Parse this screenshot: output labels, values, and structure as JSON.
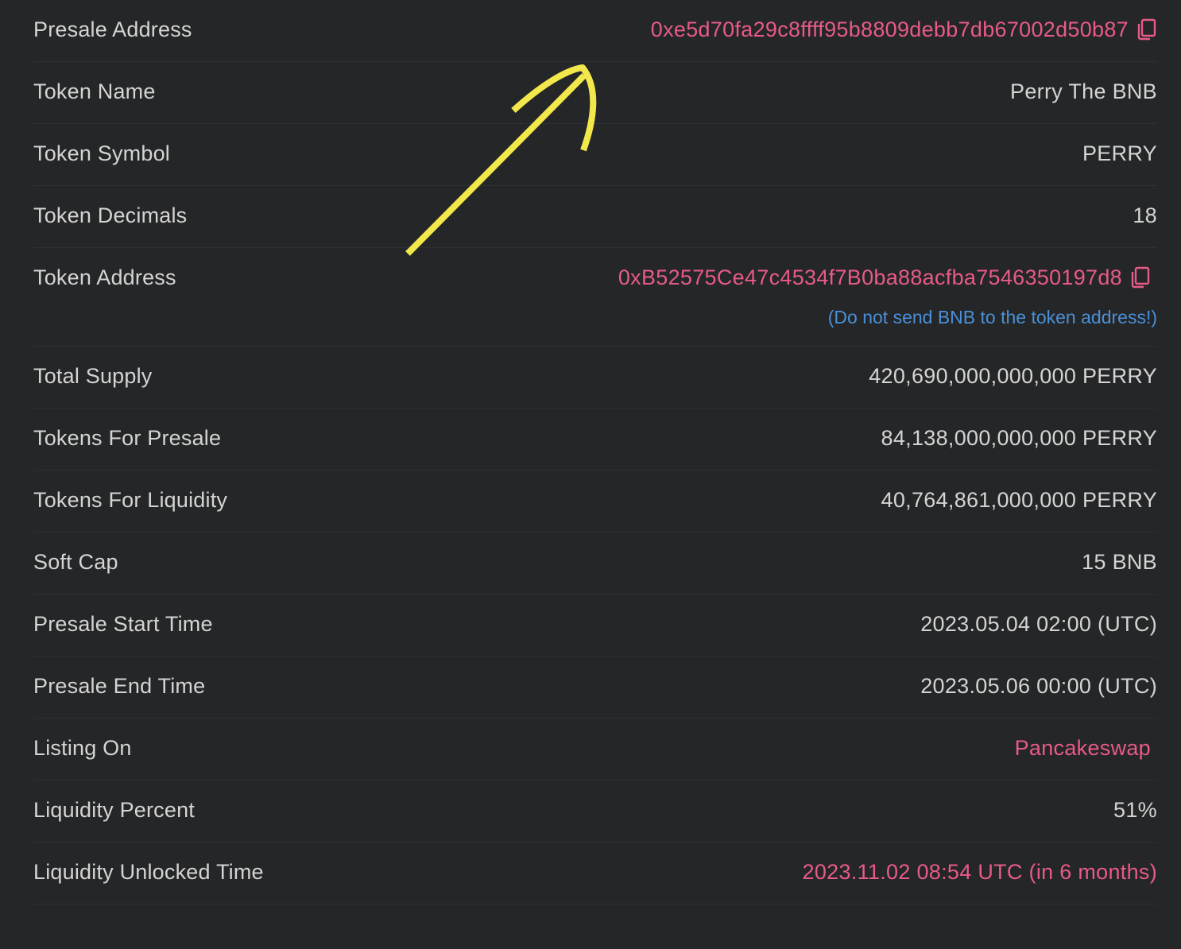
{
  "rows": [
    {
      "label": "Presale Address",
      "value": "0xe5d70fa29c8ffff95b8809debb7db67002d50b87"
    },
    {
      "label": "Token Name",
      "value": "Perry The BNB"
    },
    {
      "label": "Token Symbol",
      "value": "PERRY"
    },
    {
      "label": "Token Decimals",
      "value": "18"
    },
    {
      "label": "Token Address",
      "value": "0xB52575Ce47c4534f7B0ba88acfba7546350197d8",
      "note": "(Do not send BNB to the token address!)"
    },
    {
      "label": "Total Supply",
      "value": "420,690,000,000,000 PERRY"
    },
    {
      "label": "Tokens For Presale",
      "value": "84,138,000,000,000 PERRY"
    },
    {
      "label": "Tokens For Liquidity",
      "value": "40,764,861,000,000 PERRY"
    },
    {
      "label": "Soft Cap",
      "value": "15 BNB"
    },
    {
      "label": "Presale Start Time",
      "value": "2023.05.04 02:00 (UTC)"
    },
    {
      "label": "Presale End Time",
      "value": "2023.05.06 00:00 (UTC)"
    },
    {
      "label": "Listing On",
      "value": "Pancakeswap"
    },
    {
      "label": "Liquidity Percent",
      "value": "51%"
    },
    {
      "label": "Liquidity Unlocked Time",
      "value": "2023.11.02 08:54 UTC (in 6 months)"
    }
  ],
  "icons": {
    "copy": "copy-icon",
    "annotation": "arrow-annotation"
  },
  "colors": {
    "background": "#252627",
    "text": "#d4d4d4",
    "link": "#e85a8a",
    "note": "#4a90d9",
    "annotation": "#f2e84b"
  }
}
